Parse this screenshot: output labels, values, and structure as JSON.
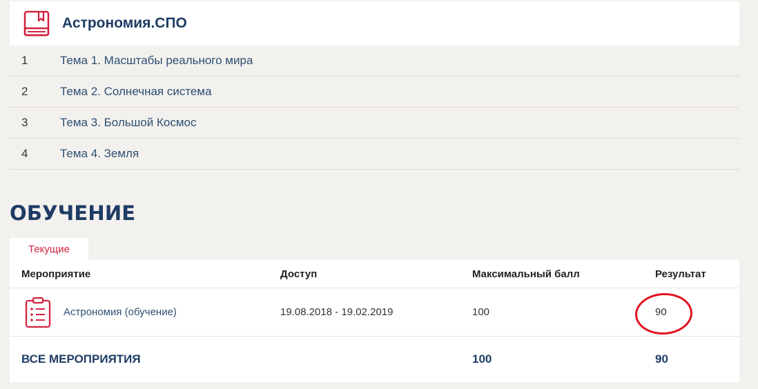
{
  "course": {
    "title": "Астрономия.СПО",
    "icon": "book-icon"
  },
  "topics": [
    {
      "num": "1",
      "title": "Тема 1. Масштабы реального мира"
    },
    {
      "num": "2",
      "title": "Тема 2. Солнечная система"
    },
    {
      "num": "3",
      "title": "Тема 3. Большой Космос"
    },
    {
      "num": "4",
      "title": "Тема 4. Земля"
    }
  ],
  "learning": {
    "section_title": "ОБУЧЕНИЕ",
    "tab_label": "Текущие",
    "columns": [
      "Мероприятие",
      "Доступ",
      "Максимальный балл",
      "Результат"
    ],
    "rows": [
      {
        "icon": "checklist-clipboard-icon",
        "event": "Астрономия (обучение)",
        "access": "19.08.2018 - 19.02.2019",
        "max_score": "100",
        "result": "90"
      }
    ],
    "total": {
      "label": "ВСЕ МЕРОПРИЯТИЯ",
      "max_score": "100",
      "result": "90"
    }
  },
  "colors": {
    "accent": "#d3223f",
    "title": "#1e3c64",
    "link": "#2c4f73",
    "background": "#f3f1ee",
    "annotation": "#e0141e"
  }
}
